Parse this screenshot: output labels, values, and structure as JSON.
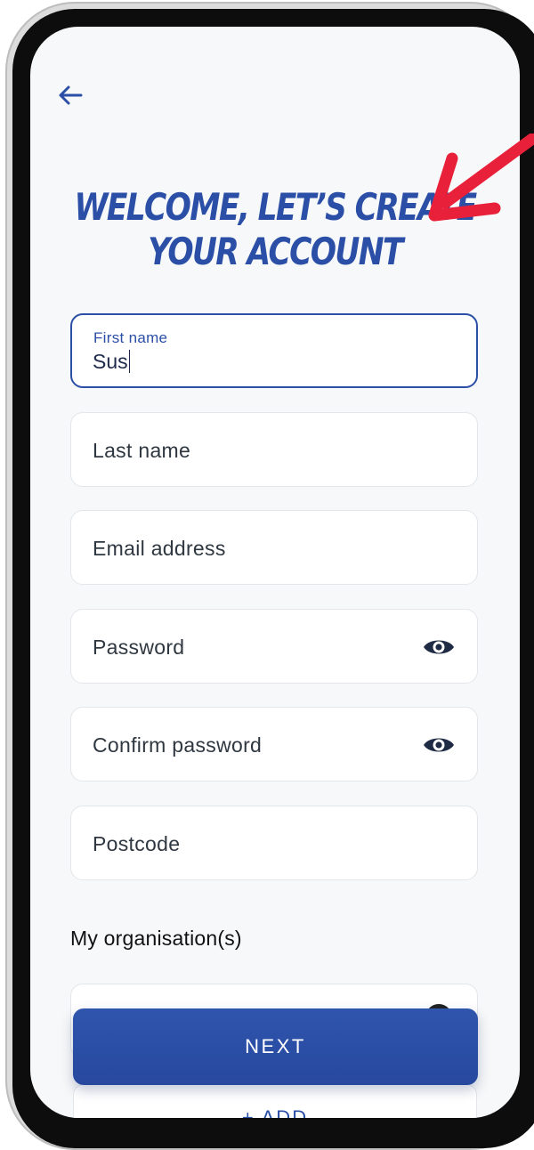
{
  "header": {
    "back_icon": "arrow-left-icon"
  },
  "headline": {
    "line1": "WELCOME, LET’S CREATE",
    "line2": "YOUR ACCOUNT"
  },
  "form": {
    "first_name": {
      "label": "First name",
      "value": "Sus"
    },
    "last_name": {
      "label": "Last name"
    },
    "email": {
      "label": "Email address"
    },
    "password": {
      "label": "Password",
      "icon": "eye-icon"
    },
    "confirm_password": {
      "label": "Confirm password",
      "icon": "eye-icon"
    },
    "postcode": {
      "label": "Postcode"
    }
  },
  "organisations": {
    "title": "My organisation(s)",
    "add_label": "+ ADD"
  },
  "actions": {
    "next_label": "NEXT"
  },
  "colors": {
    "brand": "#2b4fa6",
    "annotation": "#e8203a",
    "background": "#f7f8f9"
  }
}
